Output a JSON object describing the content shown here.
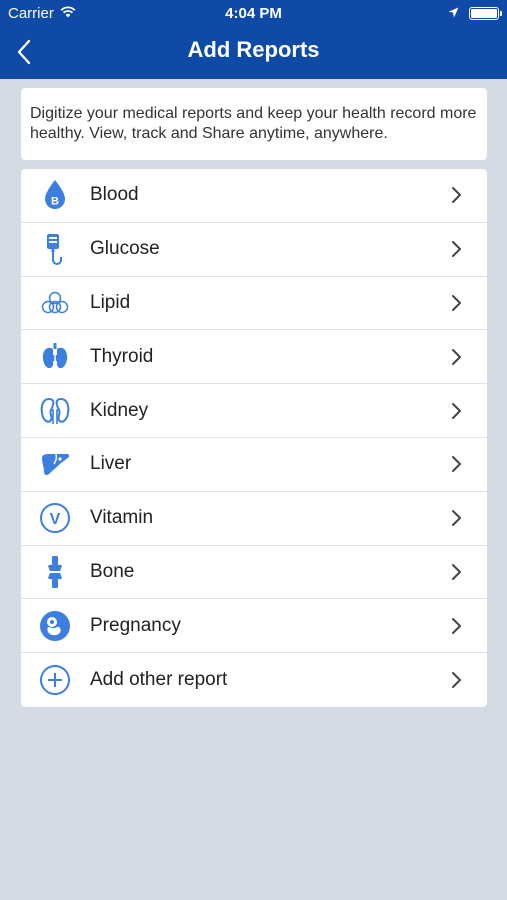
{
  "status_bar": {
    "carrier": "Carrier",
    "time": "4:04 PM",
    "icons": [
      "wifi-icon",
      "location-icon",
      "battery-icon"
    ]
  },
  "header": {
    "title": "Add Reports",
    "back_icon": "back-chevron-icon",
    "background": "#0e4aa6"
  },
  "intro": {
    "text": "Digitize your medical reports and keep your health record more healthy. View, track and Share anytime, anywhere."
  },
  "reports": [
    {
      "label": "Blood",
      "icon": "blood-drop-icon"
    },
    {
      "label": "Glucose",
      "icon": "glucose-drip-icon"
    },
    {
      "label": "Lipid",
      "icon": "lipid-cells-icon"
    },
    {
      "label": "Thyroid",
      "icon": "thyroid-icon"
    },
    {
      "label": "Kidney",
      "icon": "kidney-icon"
    },
    {
      "label": "Liver",
      "icon": "liver-icon"
    },
    {
      "label": "Vitamin",
      "icon": "vitamin-icon"
    },
    {
      "label": "Bone",
      "icon": "bone-icon"
    },
    {
      "label": "Pregnancy",
      "icon": "pregnancy-icon"
    },
    {
      "label": "Add other report",
      "icon": "plus-circle-icon"
    }
  ],
  "colors": {
    "accent": "#3d7fe0",
    "page_background": "#d4dbe3"
  }
}
